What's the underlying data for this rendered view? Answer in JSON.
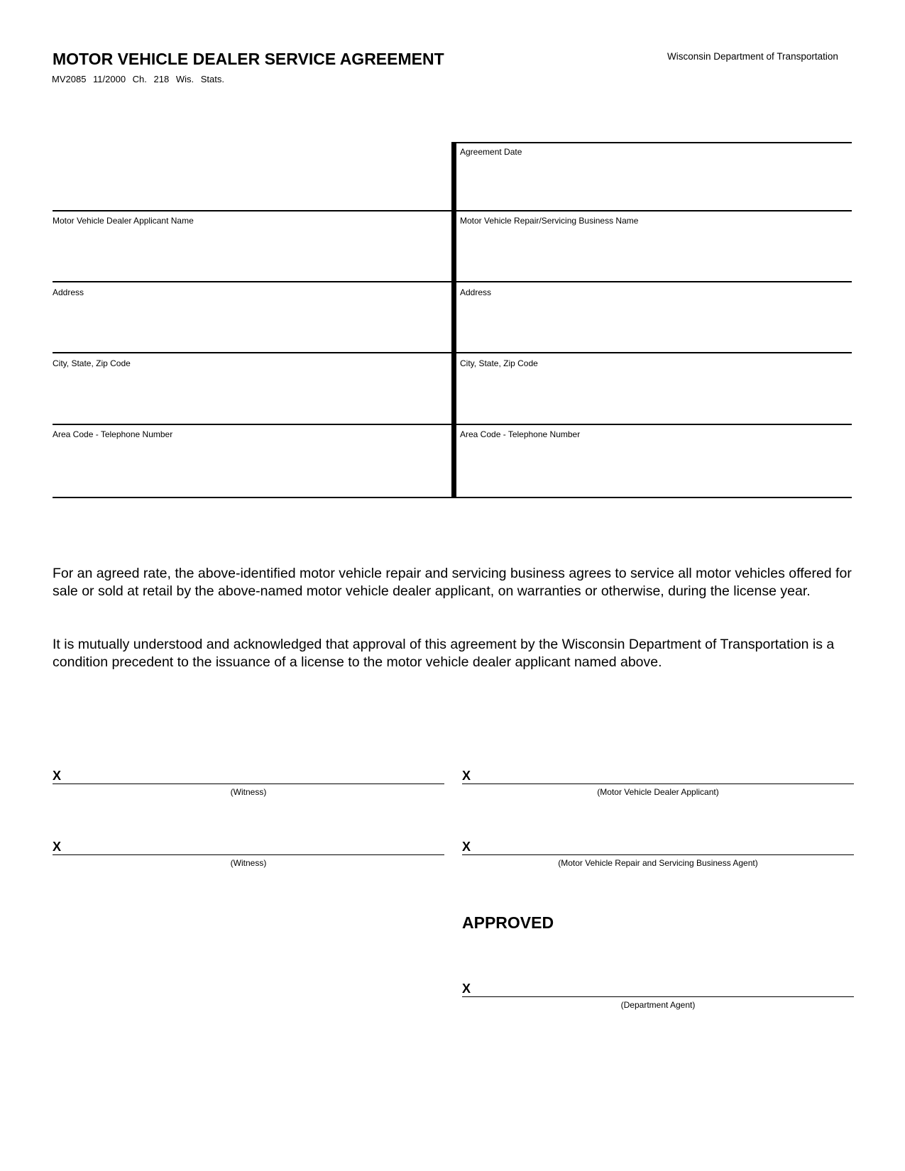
{
  "header": {
    "title": "MOTOR VEHICLE DEALER SERVICE AGREEMENT",
    "form_info": "MV2085   11/2000   Ch. 218 Wis. Stats.",
    "agency": "Wisconsin Department of Transportation"
  },
  "form": {
    "agreement_date_label": "Agreement Date",
    "agreement_date_value": "",
    "dealer": {
      "name_label": "Motor Vehicle Dealer Applicant Name",
      "address_label": "Address",
      "city_label": "City, State, Zip Code",
      "phone_label": "Area Code - Telephone Number",
      "name_value": "",
      "address_value": "",
      "city_value": "",
      "phone_value": ""
    },
    "servicer": {
      "name_label": "Motor Vehicle Repair/Servicing Business Name",
      "address_label": "Address",
      "city_label": "City, State, Zip Code",
      "phone_label": "Area Code - Telephone Number",
      "name_value": "",
      "address_value": "",
      "city_value": "",
      "phone_value": ""
    }
  },
  "body": {
    "paragraph1": "For an agreed rate, the above-identified motor vehicle repair and servicing business agrees to service all motor vehicles offered for sale or sold at retail by the above-named motor vehicle dealer applicant, on warranties or otherwise, during the license year.",
    "paragraph2": "It is mutually understood and acknowledged that approval of this agreement by the Wisconsin Department of Transportation is a condition precedent to the issuance of a license to the motor vehicle dealer applicant named above."
  },
  "signatures": {
    "x_mark": "X",
    "witness1": "(Witness)",
    "dealer_applicant": "(Motor Vehicle Dealer Applicant)",
    "witness2": "(Witness)",
    "business_agent": "(Motor Vehicle Repair and Servicing Business Agent)",
    "approved_heading": "APPROVED",
    "department_agent": "(Department Agent)"
  }
}
